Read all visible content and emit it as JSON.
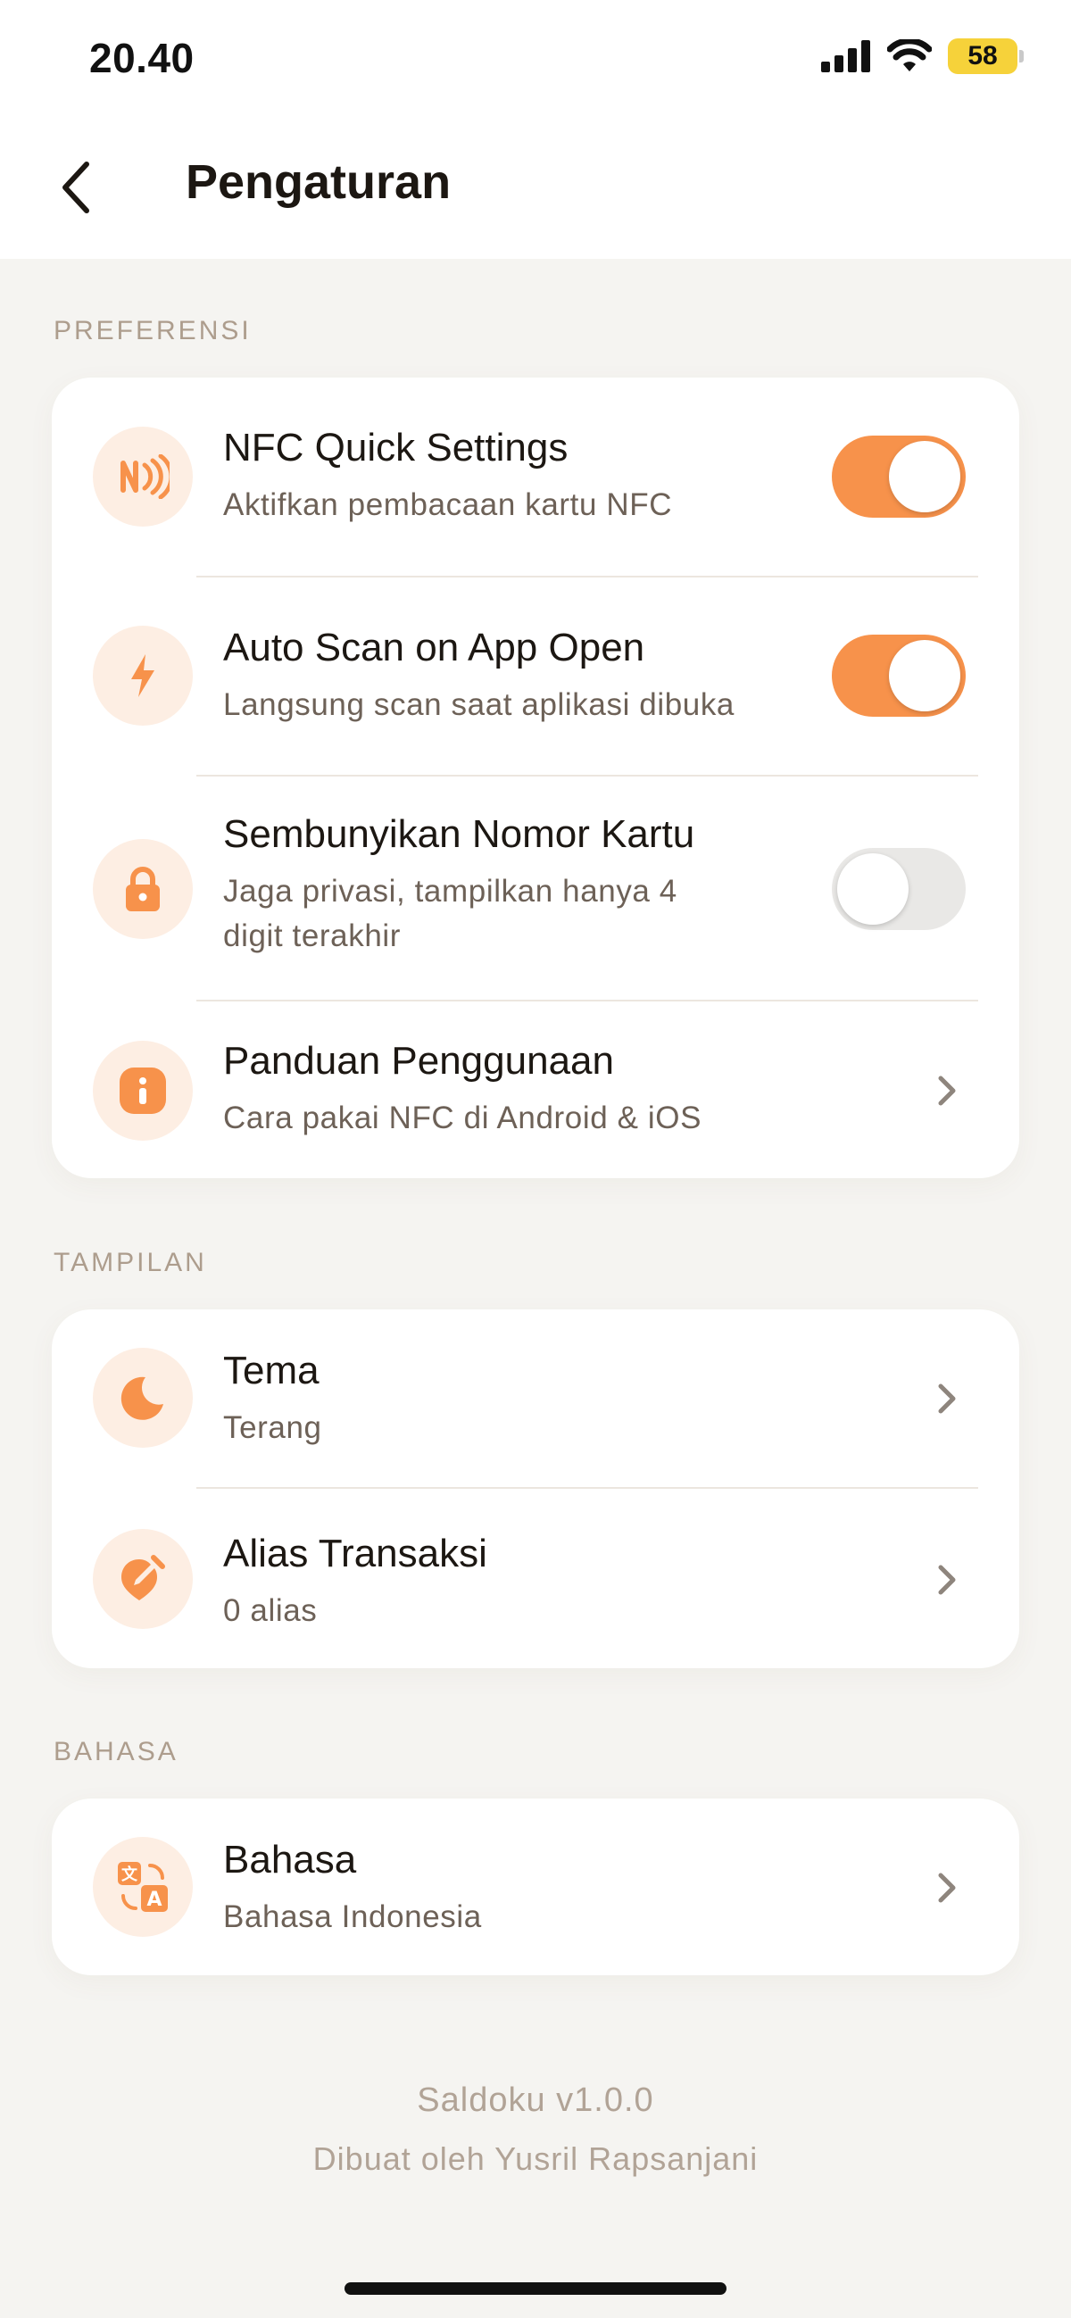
{
  "status_bar": {
    "time": "20.40",
    "battery": "58"
  },
  "header": {
    "title": "Pengaturan"
  },
  "sections": {
    "preferensi": {
      "label": "PREFERENSI",
      "items": [
        {
          "title": "NFC Quick Settings",
          "subtitle": "Aktifkan pembacaan kartu NFC",
          "control": "toggle",
          "enabled": true,
          "icon": "nfc-icon"
        },
        {
          "title": "Auto Scan on App Open",
          "subtitle": "Langsung scan saat aplikasi dibuka",
          "control": "toggle",
          "enabled": true,
          "icon": "bolt-icon"
        },
        {
          "title": "Sembunyikan Nomor Kartu",
          "subtitle_line1": "Jaga privasi, tampilkan hanya 4",
          "subtitle_line2": "digit terakhir",
          "control": "toggle",
          "enabled": false,
          "icon": "lock-icon"
        },
        {
          "title": "Panduan Penggunaan",
          "subtitle": "Cara pakai NFC di Android & iOS",
          "control": "chevron",
          "icon": "info-icon"
        }
      ]
    },
    "tampilan": {
      "label": "TAMPILAN",
      "items": [
        {
          "title": "Tema",
          "subtitle": "Terang",
          "control": "chevron",
          "icon": "moon-icon"
        },
        {
          "title": "Alias Transaksi",
          "subtitle": "0 alias",
          "control": "chevron",
          "icon": "edit-tag-icon"
        }
      ]
    },
    "bahasa": {
      "label": "BAHASA",
      "items": [
        {
          "title": "Bahasa",
          "subtitle": "Bahasa Indonesia",
          "control": "chevron",
          "icon": "translate-icon"
        }
      ]
    }
  },
  "footer": {
    "app_version": "Saldoku v1.0.0",
    "credit": "Dibuat oleh Yusril Rapsanjani"
  },
  "colors": {
    "accent": "#f7924b",
    "icon_bg": "#fdeee3",
    "background": "#f5f4f1",
    "section_label": "#ad9d8d"
  }
}
